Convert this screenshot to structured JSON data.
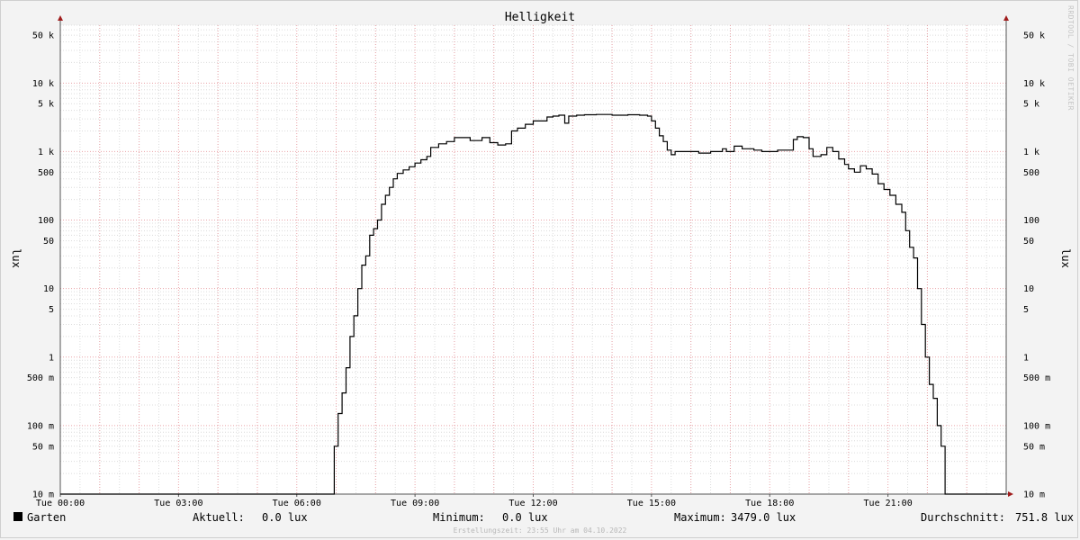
{
  "chart_data": {
    "type": "line",
    "title": "Helligkeit",
    "ylabel": "lux",
    "scale": "log",
    "ylim": [
      0.01,
      70000
    ],
    "y_ticks": [
      {
        "value": 0.01,
        "label": "10 m"
      },
      {
        "value": 0.05,
        "label": "50 m"
      },
      {
        "value": 0.1,
        "label": "100 m"
      },
      {
        "value": 0.5,
        "label": "500 m"
      },
      {
        "value": 1,
        "label": "1"
      },
      {
        "value": 5,
        "label": "5"
      },
      {
        "value": 10,
        "label": "10"
      },
      {
        "value": 50,
        "label": "50"
      },
      {
        "value": 100,
        "label": "100"
      },
      {
        "value": 500,
        "label": "500"
      },
      {
        "value": 1000,
        "label": "1 k"
      },
      {
        "value": 5000,
        "label": "5 k"
      },
      {
        "value": 10000,
        "label": "10 k"
      },
      {
        "value": 50000,
        "label": "50 k"
      }
    ],
    "x_ticks": [
      "Tue 00:00",
      "Tue 03:00",
      "Tue 06:00",
      "Tue 09:00",
      "Tue 12:00",
      "Tue 15:00",
      "Tue 18:00",
      "Tue 21:00"
    ],
    "xlim_hours": [
      0,
      24
    ],
    "grid": true,
    "series": [
      {
        "name": "Garten",
        "color": "#000000",
        "points": [
          [
            0,
            0.01
          ],
          [
            6.9,
            0.01
          ],
          [
            6.95,
            0.05
          ],
          [
            7.05,
            0.15
          ],
          [
            7.15,
            0.3
          ],
          [
            7.25,
            0.7
          ],
          [
            7.35,
            2
          ],
          [
            7.45,
            4
          ],
          [
            7.55,
            10
          ],
          [
            7.65,
            22
          ],
          [
            7.75,
            30
          ],
          [
            7.85,
            60
          ],
          [
            7.95,
            75
          ],
          [
            8.05,
            100
          ],
          [
            8.15,
            170
          ],
          [
            8.25,
            230
          ],
          [
            8.35,
            300
          ],
          [
            8.45,
            400
          ],
          [
            8.55,
            480
          ],
          [
            8.7,
            540
          ],
          [
            8.85,
            600
          ],
          [
            9.0,
            680
          ],
          [
            9.15,
            760
          ],
          [
            9.3,
            850
          ],
          [
            9.4,
            1150
          ],
          [
            9.6,
            1300
          ],
          [
            9.8,
            1400
          ],
          [
            10.0,
            1600
          ],
          [
            10.2,
            1600
          ],
          [
            10.4,
            1450
          ],
          [
            10.5,
            1450
          ],
          [
            10.7,
            1600
          ],
          [
            10.9,
            1350
          ],
          [
            11.1,
            1250
          ],
          [
            11.3,
            1300
          ],
          [
            11.45,
            2000
          ],
          [
            11.6,
            2200
          ],
          [
            11.8,
            2500
          ],
          [
            12.0,
            2800
          ],
          [
            12.2,
            2800
          ],
          [
            12.35,
            3200
          ],
          [
            12.5,
            3300
          ],
          [
            12.65,
            3400
          ],
          [
            12.8,
            2600
          ],
          [
            12.9,
            3300
          ],
          [
            13.1,
            3400
          ],
          [
            13.3,
            3450
          ],
          [
            13.6,
            3479
          ],
          [
            14.0,
            3400
          ],
          [
            14.4,
            3450
          ],
          [
            14.7,
            3400
          ],
          [
            14.9,
            3300
          ],
          [
            15.0,
            2800
          ],
          [
            15.1,
            2200
          ],
          [
            15.2,
            1700
          ],
          [
            15.3,
            1400
          ],
          [
            15.4,
            1050
          ],
          [
            15.5,
            900
          ],
          [
            15.6,
            1000
          ],
          [
            15.9,
            1000
          ],
          [
            16.2,
            950
          ],
          [
            16.5,
            1000
          ],
          [
            16.8,
            1100
          ],
          [
            16.9,
            1000
          ],
          [
            17.1,
            1200
          ],
          [
            17.3,
            1100
          ],
          [
            17.6,
            1050
          ],
          [
            17.8,
            1000
          ],
          [
            18.0,
            1000
          ],
          [
            18.2,
            1050
          ],
          [
            18.45,
            1050
          ],
          [
            18.6,
            1500
          ],
          [
            18.7,
            1650
          ],
          [
            18.85,
            1600
          ],
          [
            19.0,
            1100
          ],
          [
            19.1,
            850
          ],
          [
            19.3,
            900
          ],
          [
            19.45,
            1150
          ],
          [
            19.6,
            1000
          ],
          [
            19.75,
            780
          ],
          [
            19.9,
            650
          ],
          [
            20.0,
            560
          ],
          [
            20.15,
            500
          ],
          [
            20.3,
            620
          ],
          [
            20.45,
            560
          ],
          [
            20.6,
            470
          ],
          [
            20.75,
            340
          ],
          [
            20.9,
            280
          ],
          [
            21.05,
            230
          ],
          [
            21.2,
            170
          ],
          [
            21.35,
            130
          ],
          [
            21.45,
            70
          ],
          [
            21.55,
            40
          ],
          [
            21.65,
            28
          ],
          [
            21.75,
            10
          ],
          [
            21.85,
            3
          ],
          [
            21.95,
            1
          ],
          [
            22.05,
            0.4
          ],
          [
            22.15,
            0.25
          ],
          [
            22.25,
            0.1
          ],
          [
            22.35,
            0.05
          ],
          [
            22.45,
            0.01
          ],
          [
            24,
            0.01
          ]
        ]
      }
    ]
  },
  "legend": {
    "series_name": "Garten",
    "series_color": "#000000",
    "current_label": "Aktuell:",
    "current_value": "0.0 lux",
    "min_label": "Minimum:",
    "min_value": "0.0 lux",
    "max_label": "Maximum:",
    "max_value": "3479.0 lux",
    "avg_label": "Durchschnitt:",
    "avg_value": "751.8 lux"
  },
  "footer_text": "Erstellungszeit: 23:55 Uhr am 04.10.2022",
  "watermark_text": "RRDTOOL / TOBI OETIKER",
  "colors": {
    "background": "#f3f3f3",
    "plot_background": "#ffffff",
    "minor_grid": "#dcdcdc",
    "major_grid": "#e9a3a8",
    "axis": "#555555",
    "arrow": "#a01c1c"
  }
}
